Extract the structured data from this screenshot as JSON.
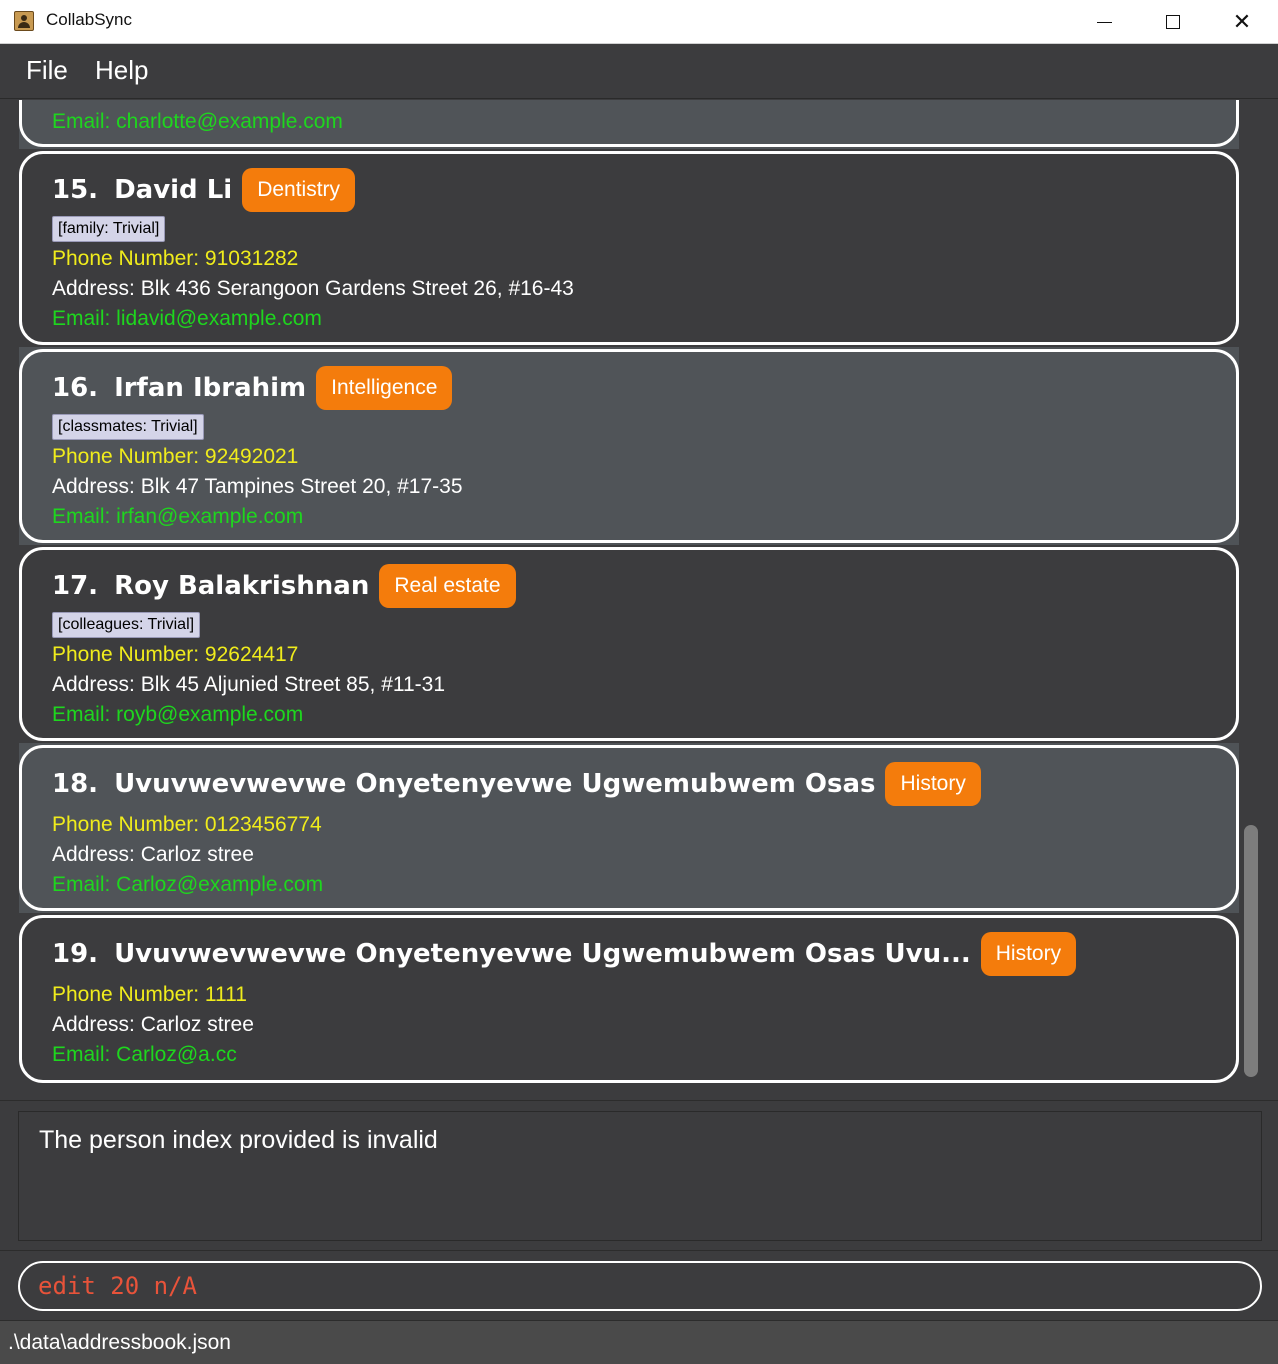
{
  "window": {
    "title": "CollabSync",
    "minimize_glyph": "",
    "close_glyph": "✕"
  },
  "menu": {
    "file": "File",
    "help": "Help"
  },
  "persons": [
    {
      "email": "Email: charlotte@example.com"
    },
    {
      "index": "15.",
      "name": "David Li",
      "tag": "Dentistry",
      "relation": "[family: Trivial]",
      "phone": "Phone Number: 91031282",
      "address": "Address: Blk 436 Serangoon Gardens Street 26, #16-43",
      "email": "Email: lidavid@example.com"
    },
    {
      "index": "16.",
      "name": "Irfan Ibrahim",
      "tag": "Intelligence",
      "relation": "[classmates: Trivial]",
      "phone": "Phone Number: 92492021",
      "address": "Address: Blk 47 Tampines Street 20, #17-35",
      "email": "Email: irfan@example.com"
    },
    {
      "index": "17.",
      "name": "Roy Balakrishnan",
      "tag": "Real estate",
      "relation": "[colleagues: Trivial]",
      "phone": "Phone Number: 92624417",
      "address": "Address: Blk 45 Aljunied Street 85, #11-31",
      "email": "Email: royb@example.com"
    },
    {
      "index": "18.",
      "name": "Uvuvwevwevwe Onyetenyevwe Ugwemubwem Osas",
      "tag": "History",
      "phone": "Phone Number: 0123456774",
      "address": "Address: Carloz stree",
      "email": "Email: Carloz@example.com"
    },
    {
      "index": "19.",
      "name": "Uvuvwevwevwe Onyetenyevwe Ugwemubwem Osas Uvu...",
      "tag": "History",
      "phone": "Phone Number: 1111",
      "address": "Address: Carloz stree",
      "email": "Email: Carloz@a.cc"
    }
  ],
  "result": {
    "message": "The person index provided is invalid"
  },
  "command": {
    "value": "edit 20 n/A"
  },
  "status": {
    "file_path": ".\\data\\addressbook.json"
  },
  "colors": {
    "tag": "#f47c0c",
    "phone": "#f0ec1c",
    "email": "#1ed61e",
    "background": "#3c3c3e",
    "card_alt": "#505458"
  }
}
